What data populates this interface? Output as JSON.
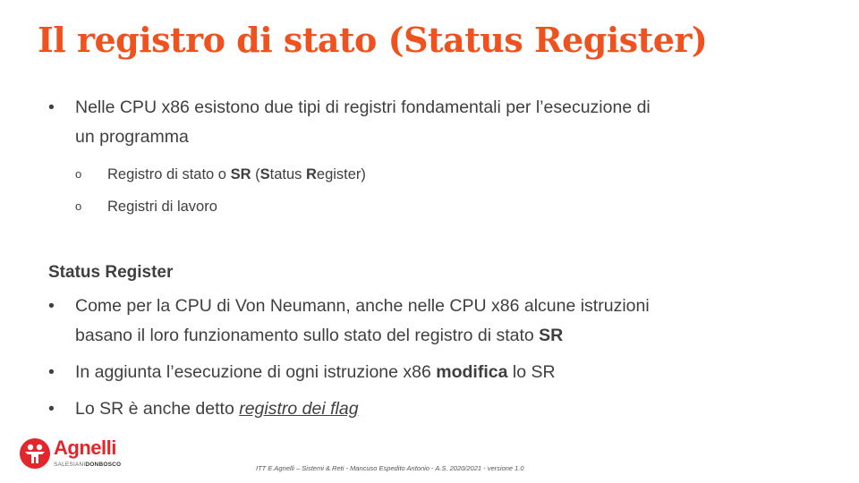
{
  "slide": {
    "title": "Il registro di stato (Status Register)"
  },
  "bullets_top": {
    "intro_line1": "Nelle CPU x86 esistono due tipi di registri fondamentali per l’esecuzione di",
    "intro_line2": "un programma",
    "sub1": {
      "a": "Registro di stato o ",
      "b": "SR",
      "c": " (",
      "d": "S",
      "e": "tatus ",
      "f": "R",
      "g": "egister)"
    },
    "sub2": "Registri di lavoro"
  },
  "section": {
    "heading": "Status Register",
    "b1_line1": "Come per la CPU di Von Neumann, anche nelle CPU x86 alcune istruzioni",
    "b1_line2": "basano il loro funzionamento sullo stato del registro di stato ",
    "b1_bold": "SR",
    "b2_a": "In aggiunta l’esecuzione di ogni  istruzione  x86 ",
    "b2_bold": "modifica",
    "b2_c": " lo SR",
    "b3_a": "Lo SR è anche detto ",
    "b3_link": "registro dei flag"
  },
  "logo": {
    "name": "Agnelli",
    "sub_a": "SALESIANI",
    "sub_b": "DONBOSCO",
    "icon": "salesian-figures-icon"
  },
  "footer": "ITT E.Agnelli – Sistemi & Reti - Mancuso Espedito Antonio - A.S. 2020/2021 - versione 1.0",
  "colors": {
    "title": "#f0521f",
    "text": "#3f3f3f",
    "brand": "#e3262b"
  }
}
